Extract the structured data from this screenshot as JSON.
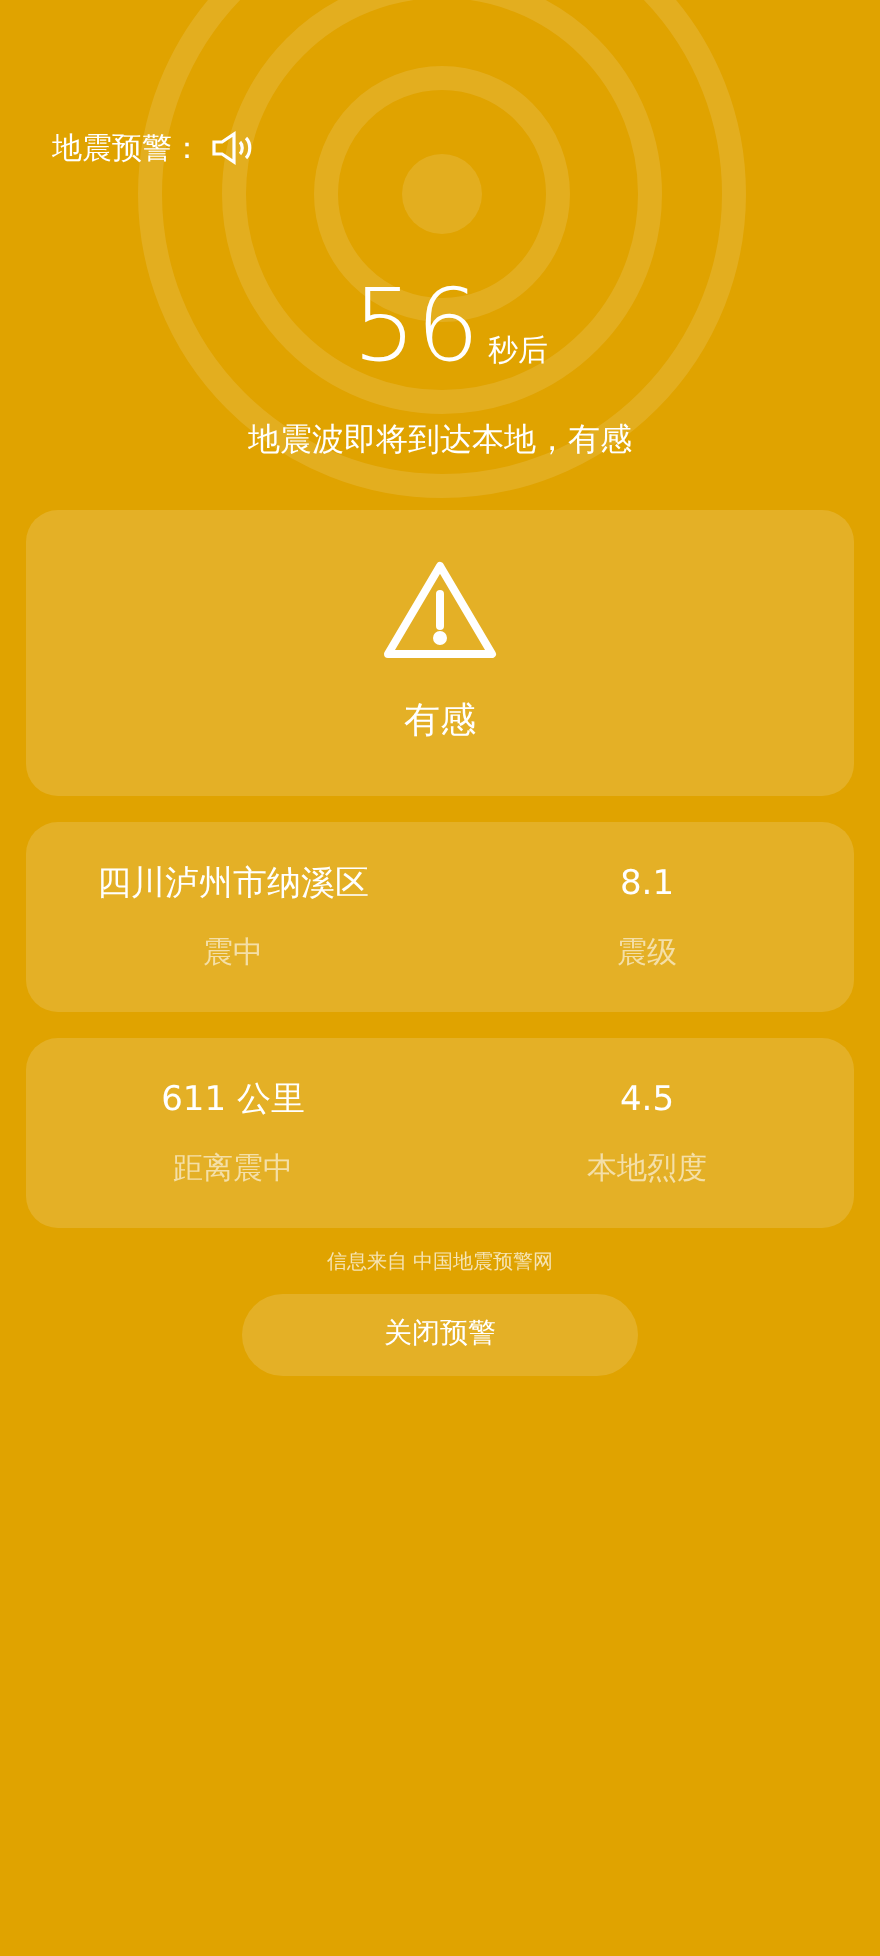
{
  "header": {
    "title": "地震预警："
  },
  "countdown": {
    "value": "56",
    "unit": "秒后"
  },
  "message": "地震波即将到达本地，有感",
  "alert": {
    "label": "有感"
  },
  "info_cards": [
    {
      "items": [
        {
          "value": "四川泸州市纳溪区",
          "label": "震中"
        },
        {
          "value": "8.1",
          "label": "震级"
        }
      ]
    },
    {
      "items": [
        {
          "value": "611 公里",
          "label": "距离震中"
        },
        {
          "value": "4.5",
          "label": "本地烈度"
        }
      ]
    }
  ],
  "source": "信息来自 中国地震预警网",
  "close_button": "关闭预警"
}
